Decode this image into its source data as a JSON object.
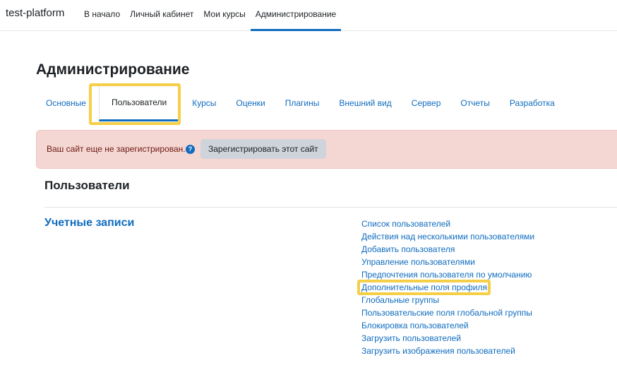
{
  "navbar": {
    "brand": "test-platform",
    "links": [
      {
        "label": "В начало"
      },
      {
        "label": "Личный кабинет"
      },
      {
        "label": "Мои курсы"
      },
      {
        "label": "Администрирование"
      }
    ],
    "active_index": 3
  },
  "page": {
    "title": "Администрирование"
  },
  "tabs": [
    {
      "label": "Основные"
    },
    {
      "label": "Пользователи"
    },
    {
      "label": "Курсы"
    },
    {
      "label": "Оценки"
    },
    {
      "label": "Плагины"
    },
    {
      "label": "Внешний вид"
    },
    {
      "label": "Сервер"
    },
    {
      "label": "Отчеты"
    },
    {
      "label": "Разработка"
    }
  ],
  "active_tab_index": 1,
  "alert": {
    "text": "Ваш сайт еще не зарегистрирован.",
    "help_icon": "question-circle-icon",
    "button_label": "Зарегистрировать этот сайт"
  },
  "section": {
    "heading": "Пользователи",
    "category_title": "Учетные записи",
    "links": [
      {
        "label": "Список пользователей"
      },
      {
        "label": "Действия над несколькими пользователями"
      },
      {
        "label": "Добавить пользователя"
      },
      {
        "label": "Управление пользователями"
      },
      {
        "label": "Предпочтения пользователя по умолчанию"
      },
      {
        "label": "Дополнительные поля профиля"
      },
      {
        "label": "Глобальные группы"
      },
      {
        "label": "Пользовательские поля глобальной группы"
      },
      {
        "label": "Блокировка пользователей"
      },
      {
        "label": "Загрузить пользователей"
      },
      {
        "label": "Загрузить изображения пользователей"
      }
    ]
  },
  "colors": {
    "link": "#0f6cbf",
    "highlight": "#f5cf48",
    "alert_bg": "#f4d6d2",
    "alert_text": "#6e1a13"
  }
}
